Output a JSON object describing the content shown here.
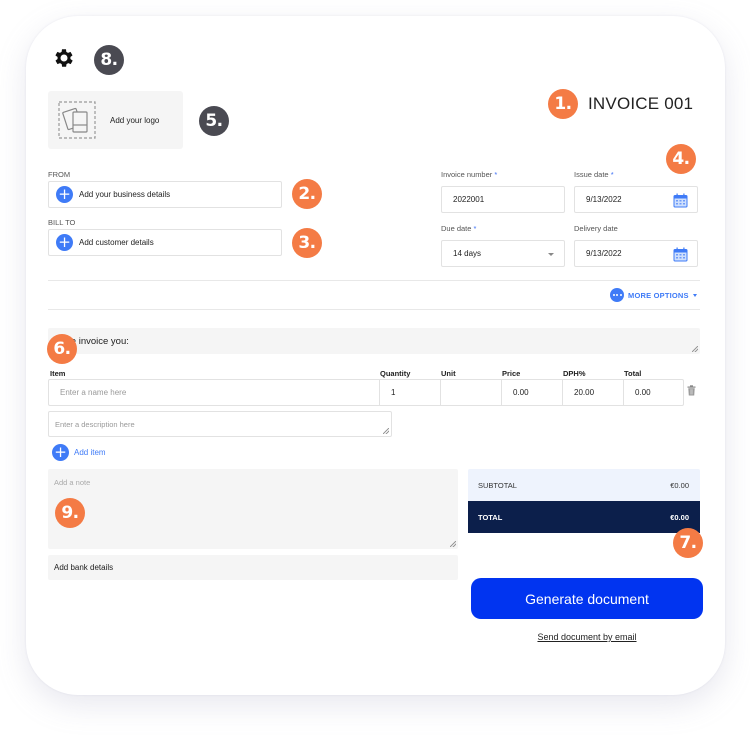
{
  "header": {
    "settings_icon": "gear-icon",
    "invoice_title": "INVOICE 001",
    "logo": {
      "label": "Add your logo",
      "icon": "image-placeholder-icon"
    }
  },
  "badges": {
    "b1": "1.",
    "b2": "2.",
    "b3": "3.",
    "b4": "4.",
    "b5": "5.",
    "b6": "6.",
    "b7": "7.",
    "b8": "8.",
    "b9": "9."
  },
  "parties": {
    "from_label": "FROM",
    "from_button": "Add your business details",
    "bill_to_label": "BILL TO",
    "bill_to_button": "Add customer details"
  },
  "meta": {
    "invoice_number_label": "Invoice number",
    "invoice_number_value": "2022001",
    "issue_date_label": "Issue date",
    "issue_date_value": "9/13/2022",
    "due_date_label": "Due date",
    "due_date_value": "14 days",
    "delivery_date_label": "Delivery date",
    "delivery_date_value": "9/13/2022",
    "required_mark": "*"
  },
  "more_options": "MORE OPTIONS",
  "intro_text": "We invoice you:",
  "items": {
    "columns": [
      "Item",
      "Quantity",
      "Unit",
      "Price",
      "DPH%",
      "Total"
    ],
    "rows": [
      {
        "name_placeholder": "Enter a name here",
        "quantity": "1",
        "unit": "",
        "price": "0.00",
        "vat": "20.00",
        "total": "0.00"
      }
    ],
    "description_placeholder": "Enter a description here",
    "add_item": "Add item"
  },
  "note_placeholder": "Add a note",
  "bank_details": "Add bank details",
  "totals": {
    "subtotal_label": "SUBTOTAL",
    "subtotal_value": "€0.00",
    "total_label": "TOTAL",
    "total_value": "€0.00"
  },
  "actions": {
    "generate": "Generate document",
    "send_email": "Send document by email"
  },
  "colors": {
    "accent": "#3f7bf7",
    "primary_button": "#0134f0",
    "total_bg": "#0c1f4b",
    "badge_orange": "#f47b45",
    "badge_gray": "#4a4a52"
  }
}
